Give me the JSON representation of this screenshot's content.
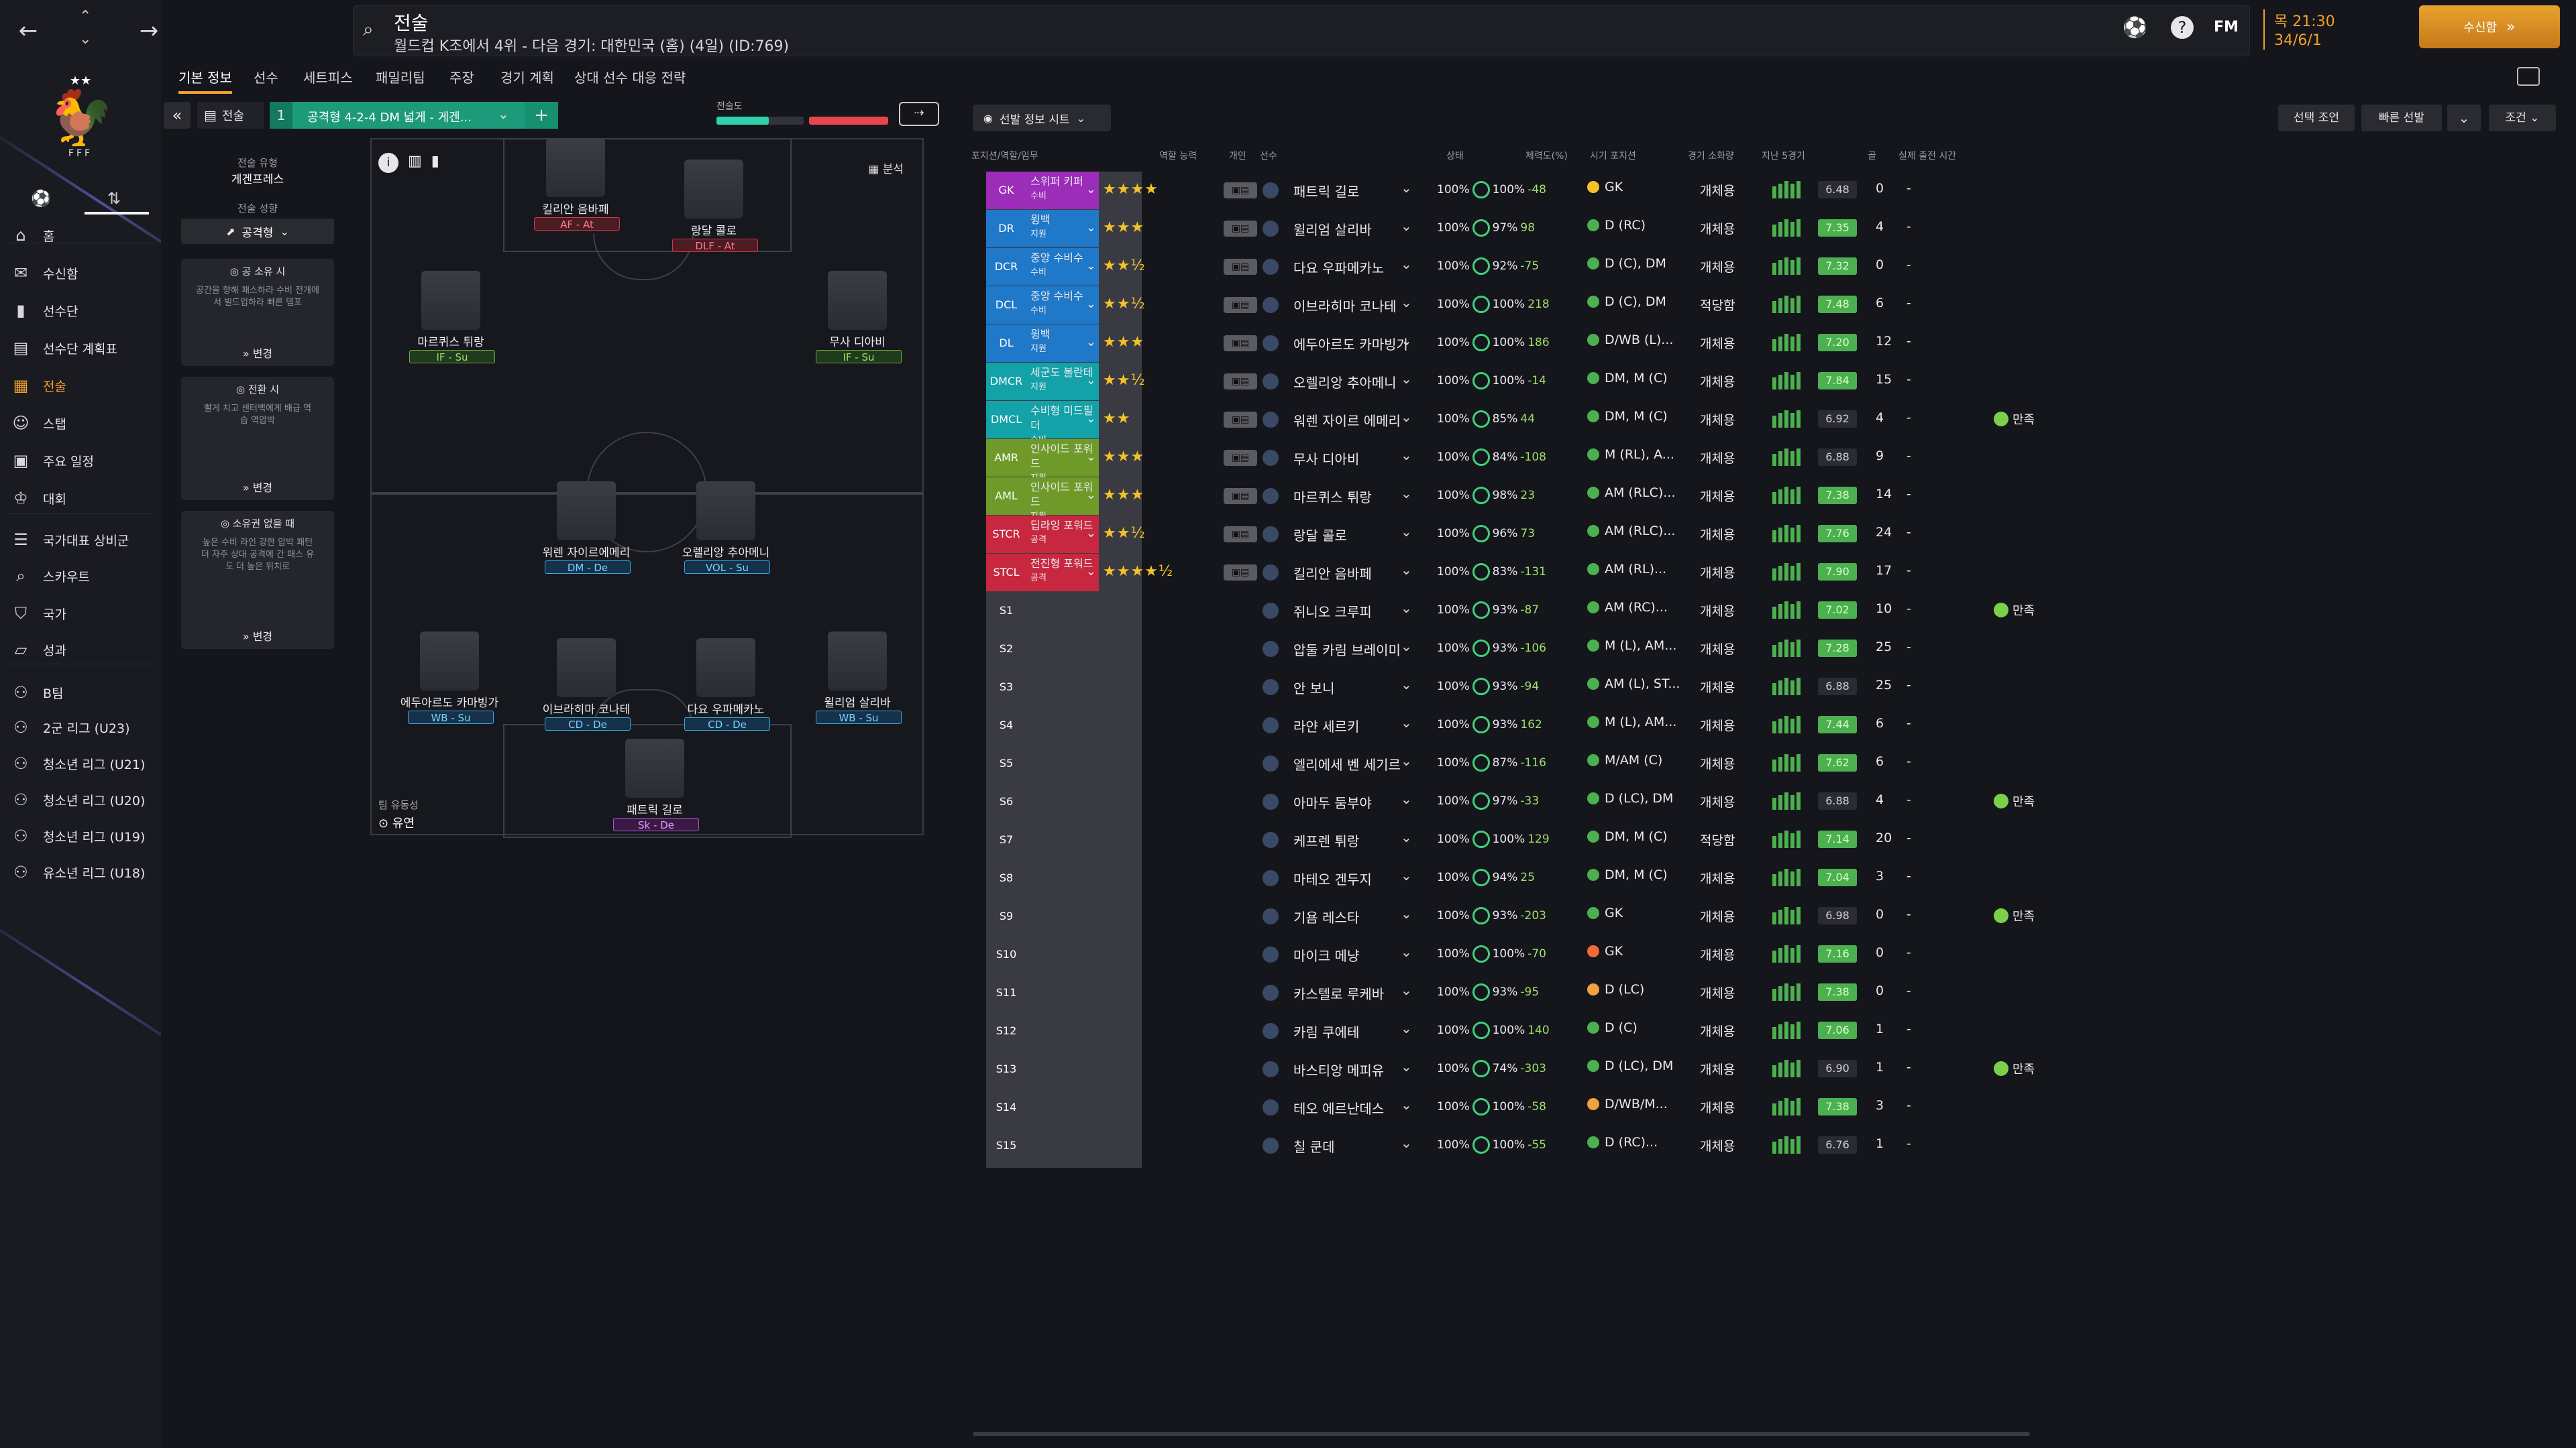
{
  "header": {
    "page_title": "전술",
    "subtitle": "월드컵 K조에서 4위 - 다음 경기: 대한민국 (홈) (4일) (ID:769)",
    "time": "목 21:30",
    "date": "34/6/1",
    "continue_label": "수신함",
    "fm_label": "FM"
  },
  "sidebar": {
    "federation": "FFF",
    "items": [
      {
        "label": "홈",
        "icon": "home-icon"
      },
      {
        "label": "수신함",
        "icon": "inbox-icon"
      },
      {
        "label": "선수단",
        "icon": "shirt-icon"
      },
      {
        "label": "선수단 계획표",
        "icon": "clipboard-icon"
      },
      {
        "label": "전술",
        "icon": "tactics-icon"
      },
      {
        "label": "스탭",
        "icon": "staff-icon"
      },
      {
        "label": "주요 일정",
        "icon": "calendar-icon"
      },
      {
        "label": "대회",
        "icon": "trophy-icon"
      },
      {
        "label": "국가대표 상비군",
        "icon": "list-icon"
      },
      {
        "label": "스카우트",
        "icon": "search-icon"
      },
      {
        "label": "국가",
        "icon": "shield-icon"
      },
      {
        "label": "성과",
        "icon": "chart-icon"
      },
      {
        "label": "B팀",
        "icon": "team-icon"
      },
      {
        "label": "2군 리그 (U23)",
        "icon": "team-icon"
      },
      {
        "label": "청소년 리그 (U21)",
        "icon": "team-icon"
      },
      {
        "label": "청소년 리그 (U20)",
        "icon": "team-icon"
      },
      {
        "label": "청소년 리그 (U19)",
        "icon": "team-icon"
      },
      {
        "label": "유소년 리그 (U18)",
        "icon": "team-icon"
      }
    ]
  },
  "tabs": [
    "기본 정보",
    "선수",
    "세트피스",
    "패밀리팀",
    "주장",
    "경기 계획",
    "상대 선수 대응 전략"
  ],
  "tactic": {
    "label": "전술",
    "slot": "1",
    "name": "공격형 4-2-4 DM 넓게 - 게겐...",
    "familiarity": "전술도",
    "analysis": "분석"
  },
  "left_panel": {
    "style_title": "전술 유형",
    "style_value": "게겐프레스",
    "mentality_title": "전술 성향",
    "mentality_value": "공격형",
    "in_possession_title": "공 소유 시",
    "in_possession_desc": "공간을 향해 패스하라 수비 전개에서 빌드업하라 빠른 템포",
    "transition_title": "전환 시",
    "transition_desc": "빨게 치고 센터백에게 배급 역습 역압박",
    "out_possession_title": "소유권 없을 때",
    "out_possession_desc": "높은 수비 라인 강한 압박 패턴 더 자주 상대 공격에 간 패스 유도 더 높은 위치로",
    "change_label": "변경",
    "fluidity_title": "팀 유동성",
    "fluidity_value": "유연"
  },
  "pitch_players": [
    {
      "name": "킬리안 음바페",
      "role": "AF - At",
      "color": "r-red"
    },
    {
      "name": "랑달 콜로",
      "role": "DLF - At",
      "color": "r-red"
    },
    {
      "name": "마르퀴스 튀랑",
      "role": "IF - Su",
      "color": "r-green"
    },
    {
      "name": "무사 디아비",
      "role": "IF - Su",
      "color": "r-green"
    },
    {
      "name": "워렌 자이르에메리",
      "role": "DM - De",
      "color": "r-blue"
    },
    {
      "name": "오렐리앙 추아메니",
      "role": "VOL - Su",
      "color": "r-blue"
    },
    {
      "name": "에두아르도 카마빙가",
      "role": "WB - Su",
      "color": "r-blue"
    },
    {
      "name": "이브라히마 코나테",
      "role": "CD - De",
      "color": "r-blue"
    },
    {
      "name": "다요 우파메카노",
      "role": "CD - De",
      "color": "r-blue"
    },
    {
      "name": "윌리엄 살리바",
      "role": "WB - Su",
      "color": "r-blue"
    },
    {
      "name": "패트릭 길로",
      "role": "Sk - De",
      "color": "r-purple"
    }
  ],
  "table": {
    "info_label": "선발 정보 시트",
    "buttons": [
      "선택 조언",
      "빠른 선발",
      "조건"
    ],
    "headers": [
      "포지션/역할/임무",
      "역할 능력",
      "개인",
      "선수",
      "상태",
      "체력도(%)",
      "시기 포지션",
      "경기 소화량",
      "지난 5경기",
      "골",
      "실제 출전 시간"
    ],
    "rows": [
      {
        "pos": "GK",
        "role": "스위퍼 키퍼",
        "duty": "수비",
        "color": "#9b2db8",
        "stars": "★★★★",
        "name": "패트릭 길로",
        "cond": "100%",
        "fit": "-48",
        "tpos": "GK",
        "tcol": "#f3c22a",
        "usage": "개체용",
        "form": [
          5,
          5,
          5,
          5,
          5
        ],
        "rating": "6.48",
        "rbg": "#2b2c32",
        "goals": "0",
        "min": "-",
        "mood": ""
      },
      {
        "pos": "DR",
        "role": "윙백",
        "duty": "지원",
        "color": "#1f78c8",
        "stars": "★★★",
        "name": "윌리엄 살리바",
        "cond": "97%",
        "fit": "98",
        "tpos": "D (RC)",
        "tcol": "#4caf50",
        "usage": "개체용",
        "form": [
          5,
          5,
          5,
          5,
          5
        ],
        "rating": "7.35",
        "rbg": "#4caf50",
        "goals": "4",
        "min": "-",
        "mood": ""
      },
      {
        "pos": "DCR",
        "role": "중앙 수비수",
        "duty": "수비",
        "color": "#1f78c8",
        "stars": "★★½",
        "name": "다요 우파메카노",
        "cond": "92%",
        "fit": "-75",
        "tpos": "D (C), DM",
        "tcol": "#4caf50",
        "usage": "개체용",
        "form": [
          5,
          5,
          5,
          5,
          5
        ],
        "rating": "7.32",
        "rbg": "#4caf50",
        "goals": "0",
        "min": "-",
        "mood": ""
      },
      {
        "pos": "DCL",
        "role": "중앙 수비수",
        "duty": "수비",
        "color": "#1f78c8",
        "stars": "★★½",
        "name": "이브라히마 코나테",
        "cond": "100%",
        "fit": "218",
        "tpos": "D (C), DM",
        "tcol": "#4caf50",
        "usage": "적당함",
        "form": [
          5,
          5,
          5,
          5,
          5
        ],
        "rating": "7.48",
        "rbg": "#4caf50",
        "goals": "6",
        "min": "-",
        "mood": ""
      },
      {
        "pos": "DL",
        "role": "윙백",
        "duty": "지원",
        "color": "#1f78c8",
        "stars": "★★★",
        "name": "에두아르도 카마빙가",
        "cond": "100%",
        "fit": "186",
        "tpos": "D/WB (L)...",
        "tcol": "#4caf50",
        "usage": "개체용",
        "form": [
          5,
          5,
          5,
          5,
          5
        ],
        "rating": "7.20",
        "rbg": "#4caf50",
        "goals": "12",
        "min": "-",
        "mood": ""
      },
      {
        "pos": "DMCR",
        "role": "세군도 볼란테",
        "duty": "지원",
        "color": "#12a2a8",
        "stars": "★★½",
        "name": "오렐리앙 추아메니",
        "cond": "100%",
        "fit": "-14",
        "tpos": "DM, M (C)",
        "tcol": "#4caf50",
        "usage": "개체용",
        "form": [
          5,
          5,
          5,
          5,
          5
        ],
        "rating": "7.84",
        "rbg": "#4caf50",
        "goals": "15",
        "min": "-",
        "mood": ""
      },
      {
        "pos": "DMCL",
        "role": "수비형 미드필더",
        "duty": "수비",
        "color": "#12a2a8",
        "stars": "★★",
        "name": "워렌 자이르 에메리",
        "cond": "85%",
        "fit": "44",
        "tpos": "DM, M (C)",
        "tcol": "#4caf50",
        "usage": "개체용",
        "form": [
          5,
          5,
          5,
          5,
          5
        ],
        "rating": "6.92",
        "rbg": "#2b2c32",
        "goals": "4",
        "min": "-",
        "mood": "만족"
      },
      {
        "pos": "AMR",
        "role": "인사이드 포워드",
        "duty": "지원",
        "color": "#6f9a2a",
        "stars": "★★★",
        "name": "무사 디아비",
        "cond": "84%",
        "fit": "-108",
        "tpos": "M (RL), A...",
        "tcol": "#4caf50",
        "usage": "개체용",
        "form": [
          5,
          5,
          5,
          5,
          5
        ],
        "rating": "6.88",
        "rbg": "#2b2c32",
        "goals": "9",
        "min": "-",
        "mood": ""
      },
      {
        "pos": "AML",
        "role": "인사이드 포워드",
        "duty": "지원",
        "color": "#6f9a2a",
        "stars": "★★★",
        "name": "마르퀴스 튀랑",
        "cond": "98%",
        "fit": "23",
        "tpos": "AM (RLC)...",
        "tcol": "#4caf50",
        "usage": "개체용",
        "form": [
          5,
          5,
          5,
          5,
          5
        ],
        "rating": "7.38",
        "rbg": "#4caf50",
        "goals": "14",
        "min": "-",
        "mood": ""
      },
      {
        "pos": "STCR",
        "role": "딥라잉 포워드",
        "duty": "공격",
        "color": "#c8283f",
        "stars": "★★½",
        "name": "랑달 콜로",
        "cond": "96%",
        "fit": "73",
        "tpos": "AM (RLC)...",
        "tcol": "#4caf50",
        "usage": "개체용",
        "form": [
          5,
          5,
          5,
          5,
          5
        ],
        "rating": "7.76",
        "rbg": "#4caf50",
        "goals": "24",
        "min": "-",
        "mood": ""
      },
      {
        "pos": "STCL",
        "role": "전진형 포워드",
        "duty": "공격",
        "color": "#c8283f",
        "stars": "★★★★½",
        "name": "킬리안 음바페",
        "cond": "83%",
        "fit": "-131",
        "tpos": "AM (RL)...",
        "tcol": "#4caf50",
        "usage": "개체용",
        "form": [
          5,
          5,
          5,
          5,
          5
        ],
        "rating": "7.90",
        "rbg": "#4caf50",
        "goals": "17",
        "min": "-",
        "mood": ""
      },
      {
        "pos": "S1",
        "role": "",
        "duty": "",
        "color": "",
        "stars": "",
        "name": "쥐니오 크루피",
        "cond": "93%",
        "fit": "-87",
        "tpos": "AM (RC)...",
        "tcol": "#4caf50",
        "usage": "개체용",
        "form": [
          5,
          5,
          5,
          5,
          5
        ],
        "rating": "7.02",
        "rbg": "#4caf50",
        "goals": "10",
        "min": "-",
        "mood": "만족"
      },
      {
        "pos": "S2",
        "role": "",
        "duty": "",
        "color": "",
        "stars": "",
        "name": "압둘 카림 브레이미",
        "cond": "93%",
        "fit": "-106",
        "tpos": "M (L), AM...",
        "tcol": "#4caf50",
        "usage": "개체용",
        "form": [
          5,
          5,
          5,
          5,
          5
        ],
        "rating": "7.28",
        "rbg": "#4caf50",
        "goals": "25",
        "min": "-",
        "mood": ""
      },
      {
        "pos": "S3",
        "role": "",
        "duty": "",
        "color": "",
        "stars": "",
        "name": "안 보니",
        "cond": "93%",
        "fit": "-94",
        "tpos": "AM (L), ST...",
        "tcol": "#4caf50",
        "usage": "개체용",
        "form": [
          5,
          5,
          5,
          5,
          5
        ],
        "rating": "6.88",
        "rbg": "#2b2c32",
        "goals": "25",
        "min": "-",
        "mood": ""
      },
      {
        "pos": "S4",
        "role": "",
        "duty": "",
        "color": "",
        "stars": "",
        "name": "라얀 세르키",
        "cond": "93%",
        "fit": "162",
        "tpos": "M (L), AM...",
        "tcol": "#4caf50",
        "usage": "개체용",
        "form": [
          5,
          5,
          5,
          5,
          5
        ],
        "rating": "7.44",
        "rbg": "#4caf50",
        "goals": "6",
        "min": "-",
        "mood": ""
      },
      {
        "pos": "S5",
        "role": "",
        "duty": "",
        "color": "",
        "stars": "",
        "name": "엘리에세 벤 세기르",
        "cond": "87%",
        "fit": "-116",
        "tpos": "M/AM (C)",
        "tcol": "#4caf50",
        "usage": "개체용",
        "form": [
          5,
          5,
          5,
          5,
          5
        ],
        "rating": "7.62",
        "rbg": "#4caf50",
        "goals": "6",
        "min": "-",
        "mood": ""
      },
      {
        "pos": "S6",
        "role": "",
        "duty": "",
        "color": "",
        "stars": "",
        "name": "아마두 둠부야",
        "cond": "97%",
        "fit": "-33",
        "tpos": "D (LC), DM",
        "tcol": "#4caf50",
        "usage": "개체용",
        "form": [
          5,
          5,
          5,
          5,
          5
        ],
        "rating": "6.88",
        "rbg": "#2b2c32",
        "goals": "4",
        "min": "-",
        "mood": "만족"
      },
      {
        "pos": "S7",
        "role": "",
        "duty": "",
        "color": "",
        "stars": "",
        "name": "케프렌 튀랑",
        "cond": "100%",
        "fit": "129",
        "tpos": "DM, M (C)",
        "tcol": "#4caf50",
        "usage": "적당함",
        "form": [
          5,
          5,
          5,
          5,
          5
        ],
        "rating": "7.14",
        "rbg": "#4caf50",
        "goals": "20",
        "min": "-",
        "mood": ""
      },
      {
        "pos": "S8",
        "role": "",
        "duty": "",
        "color": "",
        "stars": "",
        "name": "마테오 겐두지",
        "cond": "94%",
        "fit": "25",
        "tpos": "DM, M (C)",
        "tcol": "#4caf50",
        "usage": "개체용",
        "form": [
          5,
          5,
          5,
          5,
          5
        ],
        "rating": "7.04",
        "rbg": "#4caf50",
        "goals": "3",
        "min": "-",
        "mood": ""
      },
      {
        "pos": "S9",
        "role": "",
        "duty": "",
        "color": "",
        "stars": "",
        "name": "기욤 레스타",
        "cond": "93%",
        "fit": "-203",
        "tpos": "GK",
        "tcol": "#4caf50",
        "usage": "개체용",
        "form": [
          5,
          5,
          5,
          5,
          5
        ],
        "rating": "6.98",
        "rbg": "#2b2c32",
        "goals": "0",
        "min": "-",
        "mood": "만족"
      },
      {
        "pos": "S10",
        "role": "",
        "duty": "",
        "color": "",
        "stars": "",
        "name": "마이크 메냥",
        "cond": "100%",
        "fit": "-70",
        "tpos": "GK",
        "tcol": "#f06a3a",
        "usage": "개체용",
        "form": [
          5,
          5,
          5,
          5,
          5
        ],
        "rating": "7.16",
        "rbg": "#4caf50",
        "goals": "0",
        "min": "-",
        "mood": ""
      },
      {
        "pos": "S11",
        "role": "",
        "duty": "",
        "color": "",
        "stars": "",
        "name": "카스텔로 루케바",
        "cond": "93%",
        "fit": "-95",
        "tpos": "D (LC)",
        "tcol": "#f0a040",
        "usage": "개체용",
        "form": [
          5,
          5,
          5,
          5,
          5
        ],
        "rating": "7.38",
        "rbg": "#4caf50",
        "goals": "0",
        "min": "-",
        "mood": ""
      },
      {
        "pos": "S12",
        "role": "",
        "duty": "",
        "color": "",
        "stars": "",
        "name": "카림 쿠에테",
        "cond": "100%",
        "fit": "140",
        "tpos": "D (C)",
        "tcol": "#4caf50",
        "usage": "개체용",
        "form": [
          5,
          5,
          5,
          5,
          5
        ],
        "rating": "7.06",
        "rbg": "#4caf50",
        "goals": "1",
        "min": "-",
        "mood": ""
      },
      {
        "pos": "S13",
        "role": "",
        "duty": "",
        "color": "",
        "stars": "",
        "name": "바스티앙 메피유",
        "cond": "74%",
        "fit": "-303",
        "tpos": "D (LC), DM",
        "tcol": "#4caf50",
        "usage": "개체용",
        "form": [
          5,
          5,
          5,
          5,
          5
        ],
        "rating": "6.90",
        "rbg": "#2b2c32",
        "goals": "1",
        "min": "-",
        "mood": "만족"
      },
      {
        "pos": "S14",
        "role": "",
        "duty": "",
        "color": "",
        "stars": "",
        "name": "테오 에르난데스",
        "cond": "100%",
        "fit": "-58",
        "tpos": "D/WB/M...",
        "tcol": "#f0a040",
        "usage": "개체용",
        "form": [
          5,
          5,
          5,
          5,
          5
        ],
        "rating": "7.38",
        "rbg": "#4caf50",
        "goals": "3",
        "min": "-",
        "mood": ""
      },
      {
        "pos": "S15",
        "role": "",
        "duty": "",
        "color": "",
        "stars": "",
        "name": "칠 쿤데",
        "cond": "100%",
        "fit": "-55",
        "tpos": "D (RC)...",
        "tcol": "#4caf50",
        "usage": "개체용",
        "form": [
          5,
          5,
          5,
          5,
          5
        ],
        "rating": "6.76",
        "rbg": "#2b2c32",
        "goals": "1",
        "min": "-",
        "mood": ""
      }
    ]
  }
}
